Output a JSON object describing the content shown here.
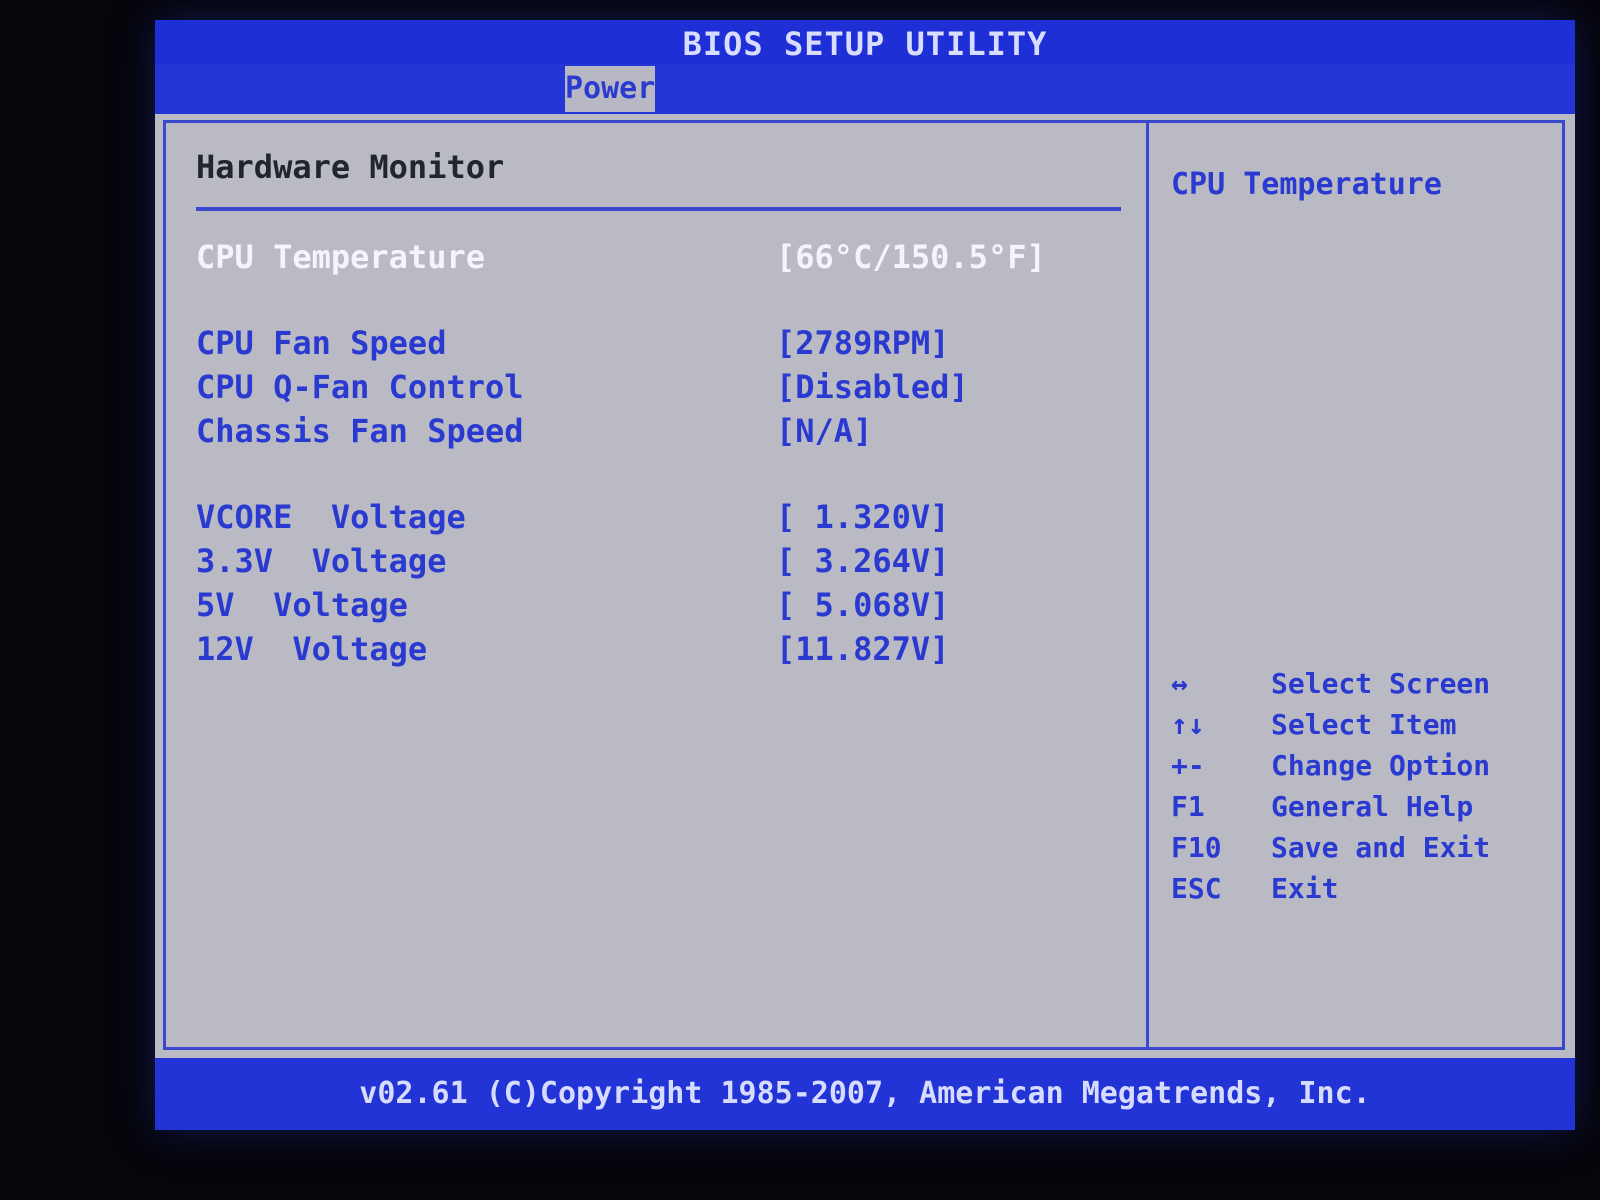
{
  "window": {
    "title": "BIOS SETUP UTILITY"
  },
  "tabs": {
    "active": "Power"
  },
  "section": {
    "title": "Hardware Monitor"
  },
  "items": {
    "cpu_temperature": {
      "label": "CPU Temperature",
      "value": "[66°C/150.5°F]"
    },
    "cpu_fan_speed": {
      "label": "CPU Fan Speed",
      "value": "[2789RPM]"
    },
    "cpu_qfan_control": {
      "label": "CPU Q-Fan Control",
      "value": "[Disabled]"
    },
    "chassis_fan_speed": {
      "label": "Chassis Fan Speed",
      "value": "[N/A]"
    },
    "vcore_voltage": {
      "label": "VCORE  Voltage",
      "value": "[ 1.320V]"
    },
    "v33_voltage": {
      "label": "3.3V  Voltage",
      "value": "[ 3.264V]"
    },
    "v5_voltage": {
      "label": "5V  Voltage",
      "value": "[ 5.068V]"
    },
    "v12_voltage": {
      "label": "12V  Voltage",
      "value": "[11.827V]"
    }
  },
  "help": {
    "title": "CPU Temperature",
    "keys": [
      {
        "key": "↔",
        "desc": "Select Screen"
      },
      {
        "key": "↑↓",
        "desc": "Select Item"
      },
      {
        "key": "+-",
        "desc": "Change Option"
      },
      {
        "key": "F1",
        "desc": "General Help"
      },
      {
        "key": "F10",
        "desc": "Save and Exit"
      },
      {
        "key": "ESC",
        "desc": "Exit"
      }
    ]
  },
  "footer": {
    "text": "v02.61 (C)Copyright 1985-2007, American Megatrends, Inc."
  },
  "colors": {
    "accent_blue": "#2234d6",
    "panel_grey": "#b9bac4",
    "selected_text": "#f4f4fb",
    "item_text": "#2a3ad0"
  }
}
